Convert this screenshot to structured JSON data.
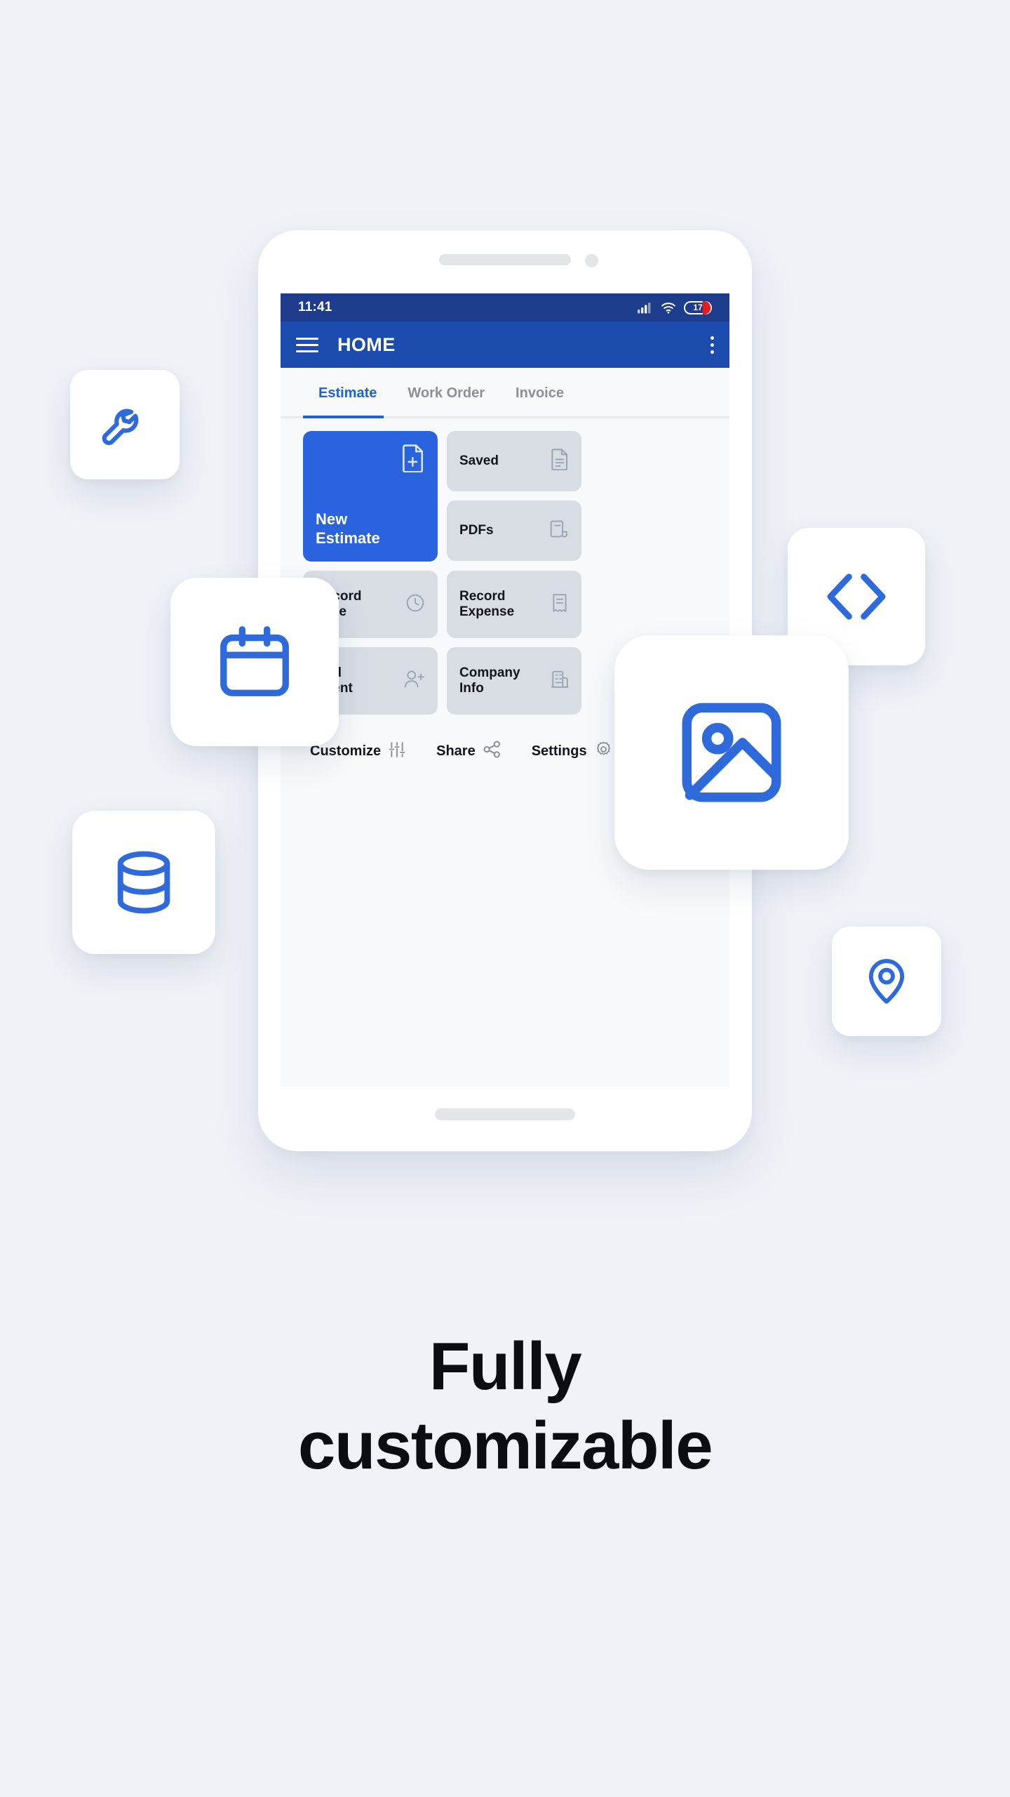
{
  "background_color": "#eff2f7",
  "accent_blue": "#2963dd",
  "appbar_blue": "#1c4cae",
  "statusbar_blue": "#1d3c8c",
  "tile_grey": "#d8dce3",
  "phone": {
    "status_bar": {
      "time": "11:41",
      "icons": [
        "signal-icon",
        "wifi-icon",
        "battery-icon"
      ],
      "battery_level": "17"
    },
    "app_bar": {
      "menu_icon": "hamburger-menu-icon",
      "title": "HOME",
      "overflow_icon": "more-vertical-icon"
    },
    "tabs": [
      {
        "label": "Estimate",
        "active": true
      },
      {
        "label": "Work Order",
        "active": false
      },
      {
        "label": "Invoice",
        "active": false
      }
    ],
    "tiles": {
      "new_estimate": {
        "label": "New\nEstimate",
        "icon": "file-plus-icon"
      },
      "saved": {
        "label": "Saved",
        "icon": "file-text-icon"
      },
      "pdfs": {
        "label": "PDFs",
        "icon": "pdf-file-icon"
      },
      "record_time": {
        "label": "Record\nTime",
        "icon": "clock-icon"
      },
      "record_expense": {
        "label": "Record\nExpense",
        "icon": "receipt-icon"
      },
      "add_client": {
        "label": "Add\nClient",
        "icon": "user-plus-icon"
      },
      "company_info": {
        "label": "Company\nInfo",
        "icon": "building-icon"
      }
    },
    "actions": [
      {
        "label": "Customize",
        "icon": "sliders-icon"
      },
      {
        "label": "Share",
        "icon": "share-icon"
      },
      {
        "label": "Settings",
        "icon": "gear-icon"
      }
    ]
  },
  "floating_cards": [
    {
      "icon": "wrench-icon"
    },
    {
      "icon": "calendar-icon"
    },
    {
      "icon": "database-icon"
    },
    {
      "icon": "code-brackets-icon"
    },
    {
      "icon": "image-icon"
    },
    {
      "icon": "location-pin-icon"
    }
  ],
  "headline": {
    "line1": "Fully",
    "line2": "customizable"
  }
}
